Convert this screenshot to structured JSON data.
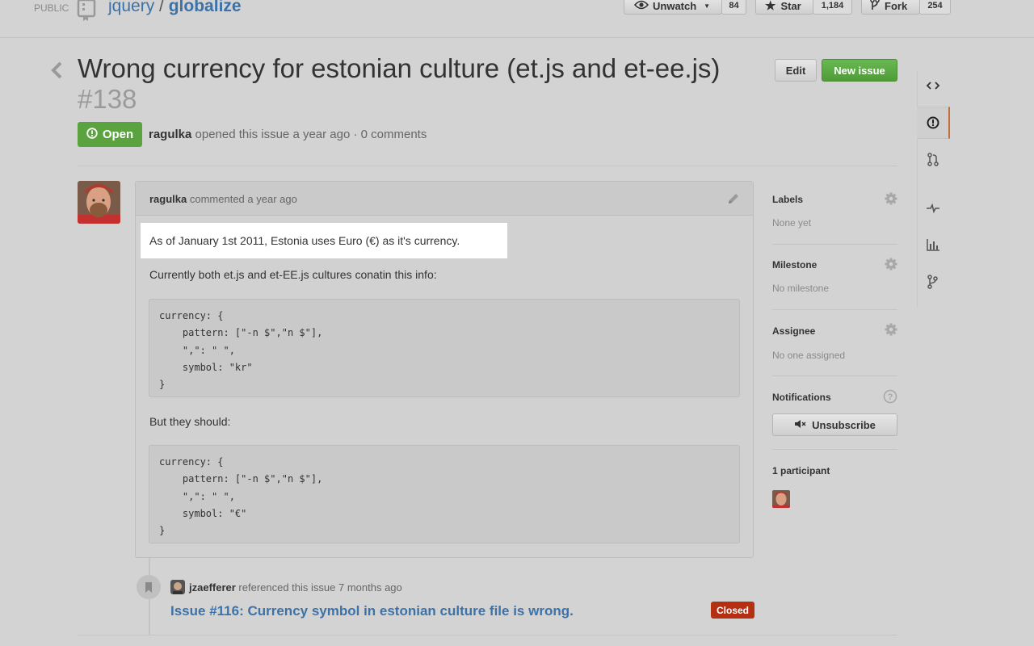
{
  "repo": {
    "visibility": "PUBLIC",
    "owner": "jquery",
    "name": "globalize",
    "separator": "/"
  },
  "header_buttons": {
    "watch": {
      "label": "Unwatch",
      "count": "84"
    },
    "star": {
      "label": "Star",
      "count": "1,184"
    },
    "fork": {
      "label": "Fork",
      "count": "254"
    }
  },
  "issue": {
    "title": "Wrong currency for estonian culture (et.js and et-ee.js)",
    "number": "#138",
    "status": "Open",
    "author": "ragulka",
    "meta_text": " opened this issue a year ago · 0 comments"
  },
  "actions": {
    "edit": "Edit",
    "new_issue": "New issue"
  },
  "comment": {
    "author": "ragulka",
    "meta": " commented a year ago",
    "para1": "As of January 1st 2011, Estonia uses Euro (€) as it's currency.",
    "para2": "Currently both et.js and et-EE.js cultures conatin this info:",
    "code1": "currency: {\n    pattern: [\"-n $\",\"n $\"],\n    \",\": \" \",\n    symbol: \"kr\"\n}",
    "para3": "But they should:",
    "code2": "currency: {\n    pattern: [\"-n $\",\"n $\"],\n    \",\": \" \",\n    symbol: \"€\"\n}"
  },
  "reference": {
    "user": "jzaefferer",
    "text": " referenced this issue 7 months ago",
    "link": "Issue #116: Currency symbol in estonian culture file is wrong.",
    "state": "Closed"
  },
  "sidebar": {
    "labels": {
      "title": "Labels",
      "value": "None yet"
    },
    "milestone": {
      "title": "Milestone",
      "value": "No milestone"
    },
    "assignee": {
      "title": "Assignee",
      "value": "No one assigned"
    },
    "notifications": {
      "title": "Notifications",
      "button": "Unsubscribe"
    },
    "participants": {
      "title": "1 participant"
    }
  },
  "colors": {
    "open": "#5ba33f",
    "closed": "#b52f12",
    "link": "#3c72a8",
    "new_issue": "#5aa846"
  }
}
